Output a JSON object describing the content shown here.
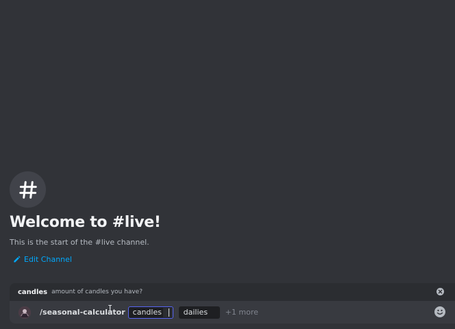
{
  "channel": {
    "welcome_title": "Welcome to #live!",
    "welcome_subtitle": "This is the start of the #live channel.",
    "edit_label": "Edit Channel",
    "icon": "hash-icon"
  },
  "command": {
    "hint_name": "candles",
    "hint_description": "amount of candles you have?",
    "name": "/seasonal-calculator",
    "options": [
      {
        "label": "candles",
        "active": true
      },
      {
        "label": "dailies",
        "active": false
      }
    ],
    "more_label": "+1 more",
    "close_icon": "close-circle-icon",
    "emoji_icon": "emoji-icon",
    "avatar_icon": "bot-avatar"
  },
  "colors": {
    "background": "#313338",
    "accent_link": "#00a8fc",
    "focus_border": "#5865f2",
    "panel": "#383a40"
  }
}
